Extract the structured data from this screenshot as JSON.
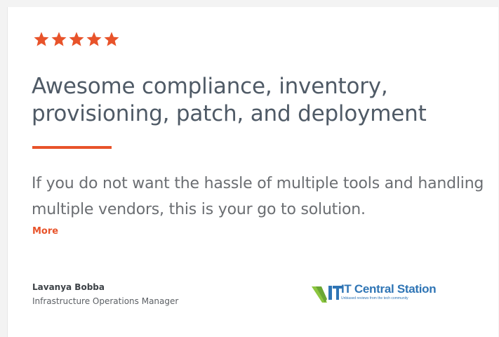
{
  "review": {
    "rating": 5,
    "rating_max": 5,
    "title": "Awesome compliance, inventory, provisioning, patch, and deployment",
    "body": "If you do not want the hassle of multiple tools and handling multiple vendors, this is your go to solution.",
    "more_label": "More"
  },
  "author": {
    "name": "Lavanya Bobba",
    "role": "Infrastructure Operations Manager"
  },
  "logo": {
    "name": "IT Central Station",
    "tagline": "Unbiased reviews from the tech community"
  },
  "colors": {
    "accent": "#e8532a",
    "title": "#4f5a66",
    "body_text": "#6b6e72",
    "logo_blue": "#2f75b5",
    "logo_green": "#8cc63f"
  },
  "icons": {
    "star": "star-icon",
    "logo_mark": "it-central-station-logo-icon"
  }
}
